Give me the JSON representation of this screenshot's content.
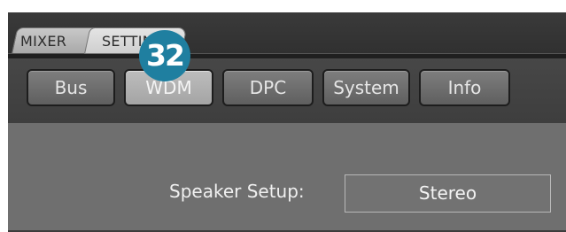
{
  "tabs": {
    "main": [
      {
        "label": "MIXER"
      },
      {
        "label": "SETTIN"
      }
    ],
    "sub": [
      {
        "label": "Bus"
      },
      {
        "label": "WDM"
      },
      {
        "label": "DPC"
      },
      {
        "label": "System"
      },
      {
        "label": "Info"
      }
    ],
    "active_sub": "WDM"
  },
  "badge": {
    "number": "32",
    "color": "#1f7fa0"
  },
  "settings": {
    "speaker_setup_label": "Speaker Setup:",
    "speaker_setup_value": "Stereo"
  }
}
